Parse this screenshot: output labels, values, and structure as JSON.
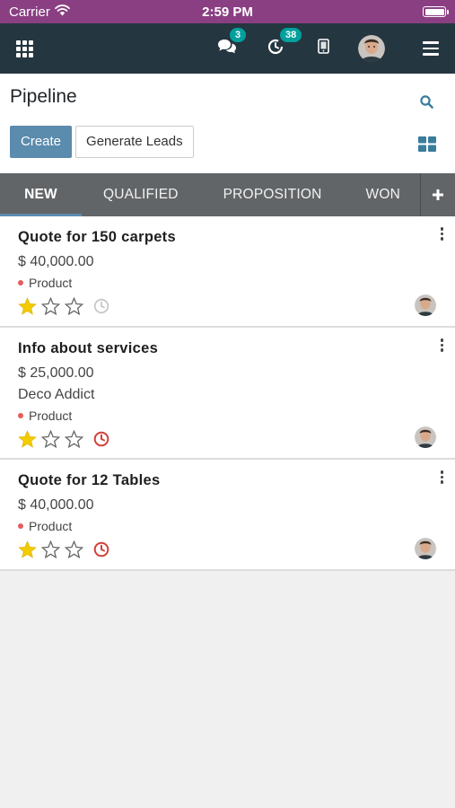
{
  "status_bar": {
    "carrier": "Carrier",
    "time": "2:59 PM"
  },
  "navbar": {
    "messages_count": "3",
    "activities_count": "38",
    "icons": [
      "apps-grid-icon",
      "chat-icon",
      "activity-clock-icon",
      "phone-icon",
      "user-avatar",
      "hamburger-menu-icon"
    ]
  },
  "control_panel": {
    "title": "Pipeline",
    "create_label": "Create",
    "generate_label": "Generate Leads"
  },
  "stages": [
    {
      "label": "NEW",
      "active": true
    },
    {
      "label": "QUALIFIED",
      "active": false
    },
    {
      "label": "PROPOSITION",
      "active": false
    },
    {
      "label": "WON",
      "active": false
    }
  ],
  "cards": [
    {
      "title": "Quote for 150 carpets",
      "amount": "$ 40,000.00",
      "partner": "",
      "tag": "Product",
      "priority_stars": 1,
      "activity_status": "none"
    },
    {
      "title": "Info about services",
      "amount": "$ 25,000.00",
      "partner": "Deco Addict",
      "tag": "Product",
      "priority_stars": 1,
      "activity_status": "overdue"
    },
    {
      "title": "Quote for 12 Tables",
      "amount": "$ 40,000.00",
      "partner": "",
      "tag": "Product",
      "priority_stars": 1,
      "activity_status": "overdue"
    }
  ],
  "colors": {
    "status_bar": "#8a3f82",
    "navbar": "#243640",
    "primary_button": "#5b8bad",
    "stage_bar": "#626567",
    "badge": "#00a09d",
    "star_filled": "#f3cc00",
    "overdue": "#d23f3a",
    "tag_dot": "#e25d5d"
  }
}
